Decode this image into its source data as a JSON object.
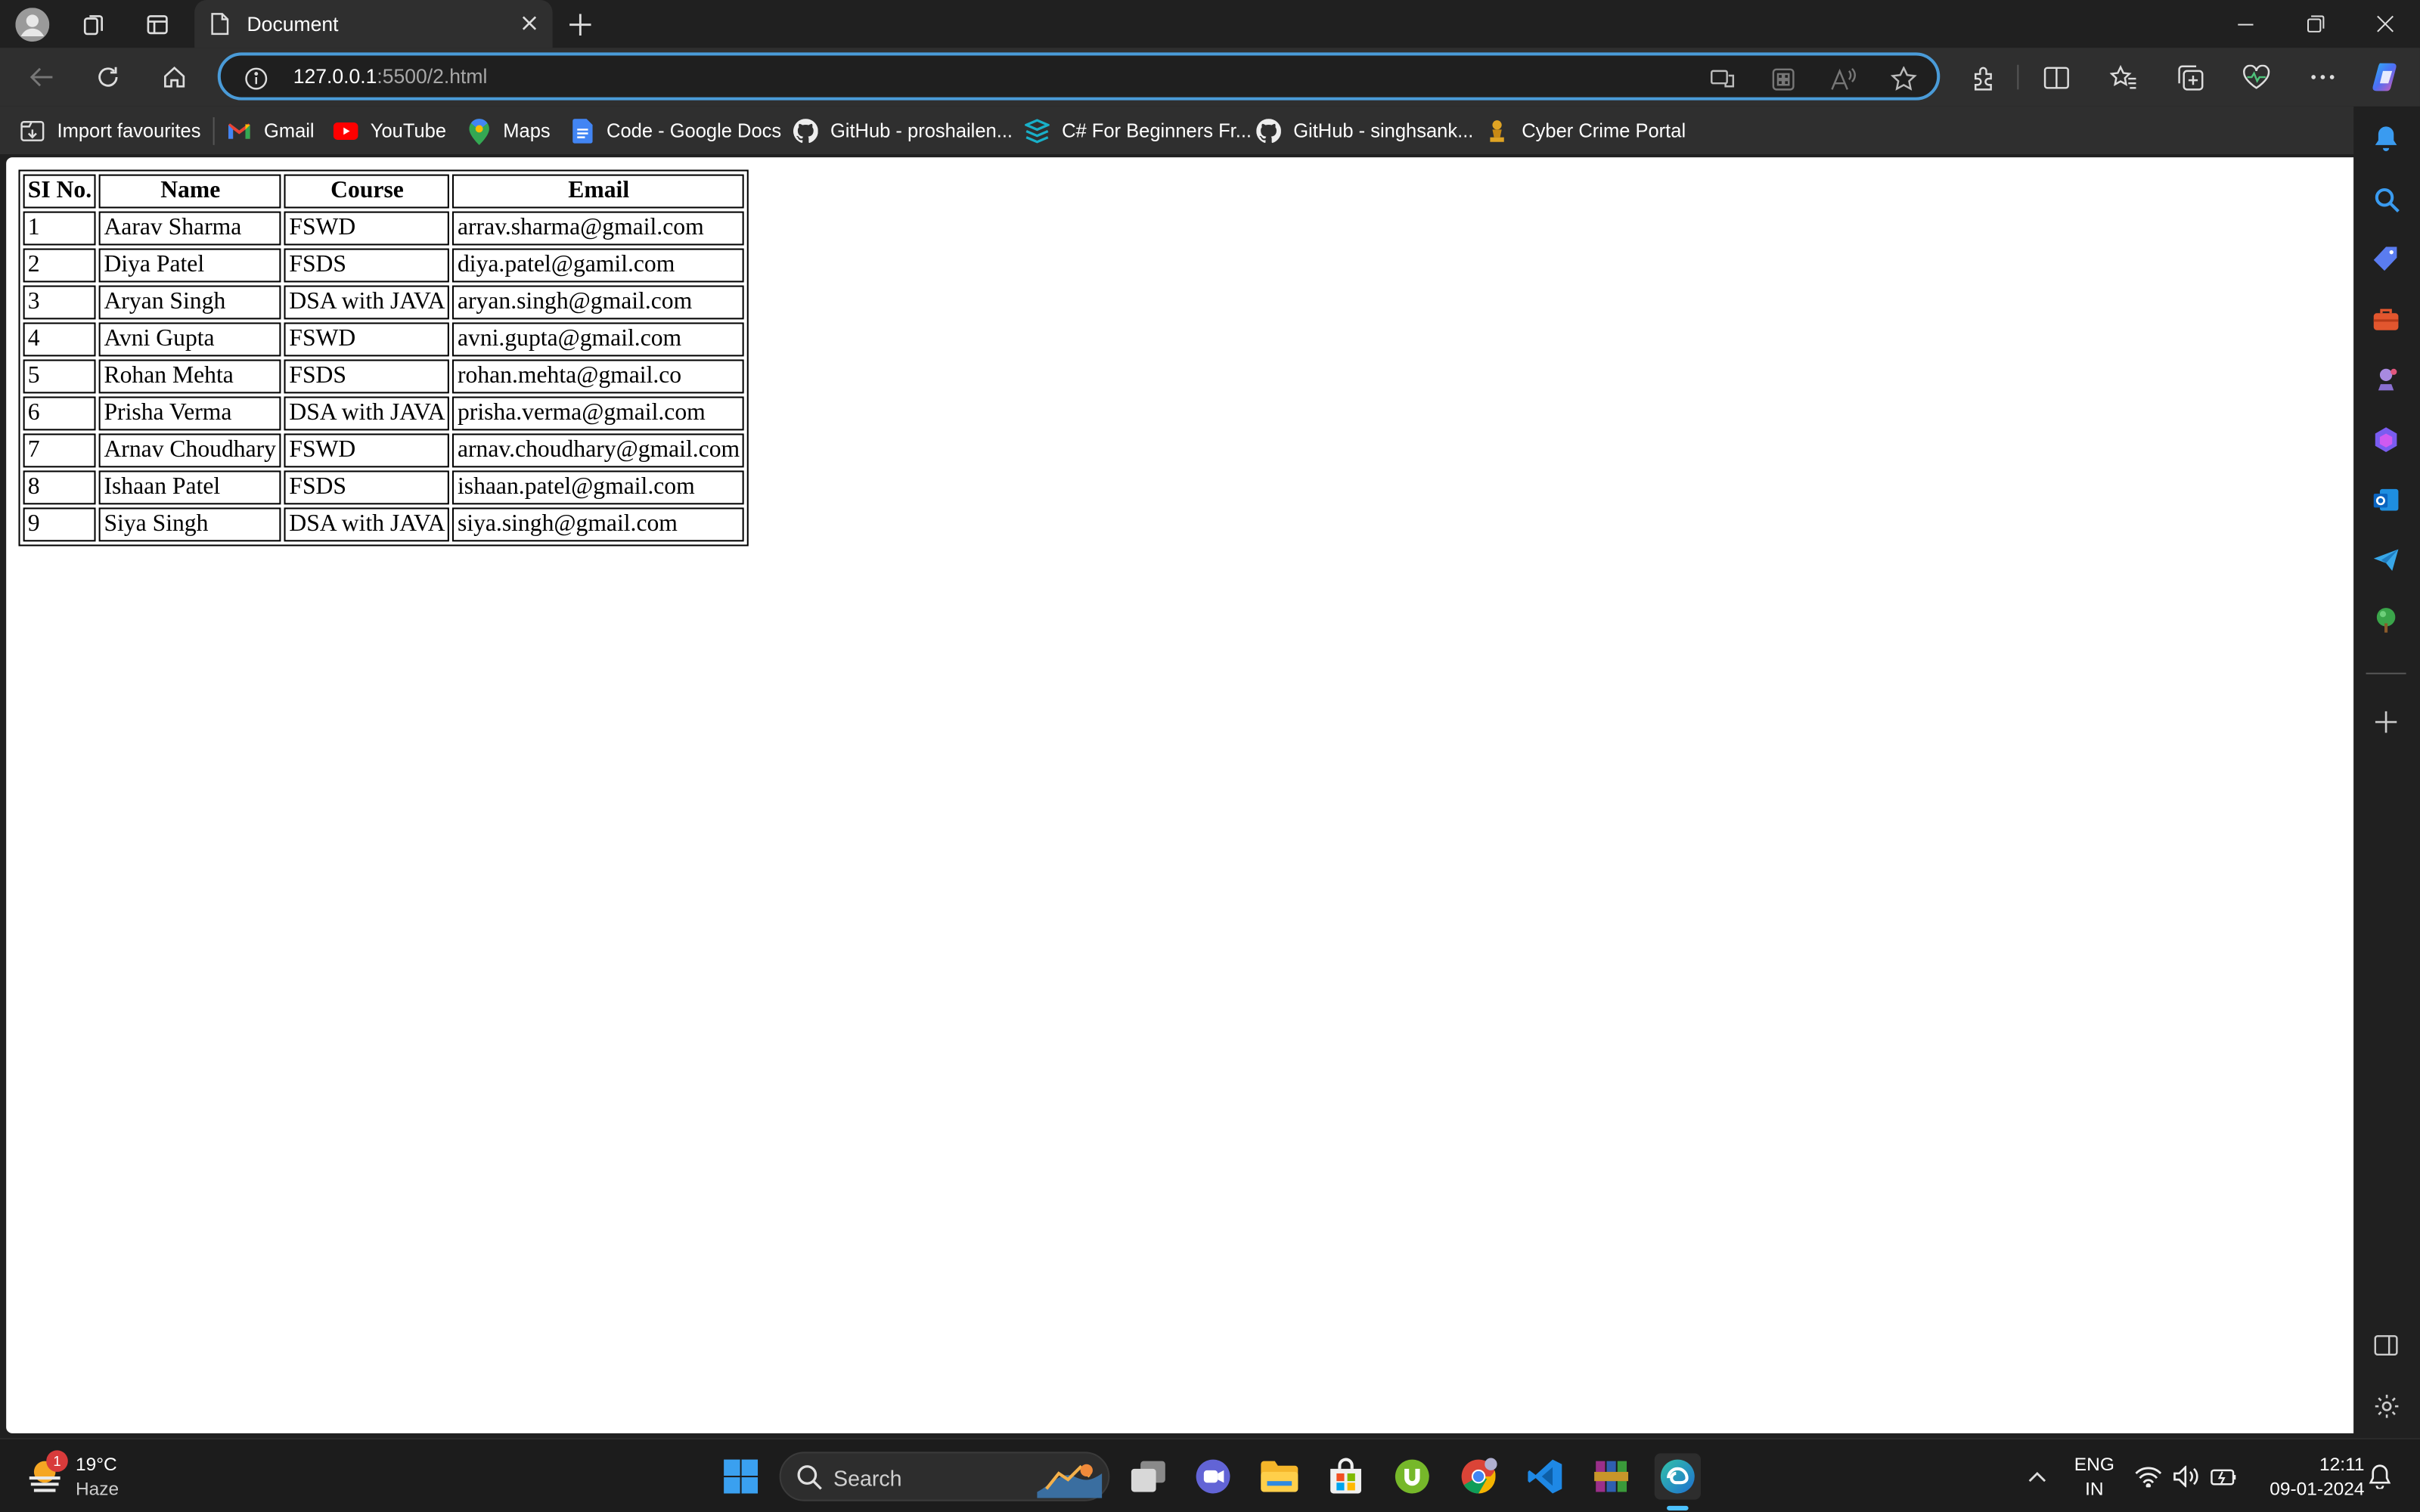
{
  "window": {
    "tab_title": "Document"
  },
  "address_bar": {
    "host": "127.0.0.1",
    "path": ":5500/2.html"
  },
  "bookmarks": [
    {
      "label": "Import favourites",
      "icon": "import-icon"
    },
    {
      "label": "Gmail",
      "icon": "gmail-icon"
    },
    {
      "label": "YouTube",
      "icon": "youtube-icon"
    },
    {
      "label": "Maps",
      "icon": "maps-icon"
    },
    {
      "label": "Code - Google Docs",
      "icon": "docs-icon"
    },
    {
      "label": "GitHub - proshailen...",
      "icon": "github-icon"
    },
    {
      "label": "C# For Beginners Fr...",
      "icon": "stack-icon"
    },
    {
      "label": "GitHub - singhsank...",
      "icon": "github-icon"
    },
    {
      "label": "Cyber Crime Portal",
      "icon": "emblem-icon"
    }
  ],
  "table": {
    "headers": [
      "SI No.",
      "Name",
      "Course",
      "Email"
    ],
    "rows": [
      [
        "1",
        "Aarav Sharma",
        "FSWD",
        "arrav.sharma@gmail.com"
      ],
      [
        "2",
        "Diya Patel",
        "FSDS",
        "diya.patel@gamil.com"
      ],
      [
        "3",
        "Aryan Singh",
        "DSA with JAVA",
        "aryan.singh@gmail.com"
      ],
      [
        "4",
        "Avni Gupta",
        "FSWD",
        "avni.gupta@gmail.com"
      ],
      [
        "5",
        "Rohan Mehta",
        "FSDS",
        "rohan.mehta@gmail.co"
      ],
      [
        "6",
        "Prisha Verma",
        "DSA with JAVA",
        "prisha.verma@gmail.com"
      ],
      [
        "7",
        "Arnav Choudhary",
        "FSWD",
        "arnav.choudhary@gmail.com"
      ],
      [
        "8",
        "Ishaan Patel",
        "FSDS",
        "ishaan.patel@gmail.com"
      ],
      [
        "9",
        "Siya Singh",
        "DSA with JAVA",
        "siya.singh@gmail.com"
      ]
    ]
  },
  "taskbar": {
    "weather_temp": "19°C",
    "weather_desc": "Haze",
    "weather_badge": "1",
    "search_label": "Search",
    "lang_top": "ENG",
    "lang_bottom": "IN",
    "time": "12:11",
    "date": "09-01-2024"
  },
  "colors": {
    "accent": "#4a9bd8",
    "chrome_dark": "#202020",
    "chrome_mid": "#2f2f2f",
    "page_bg": "#ffffff"
  }
}
